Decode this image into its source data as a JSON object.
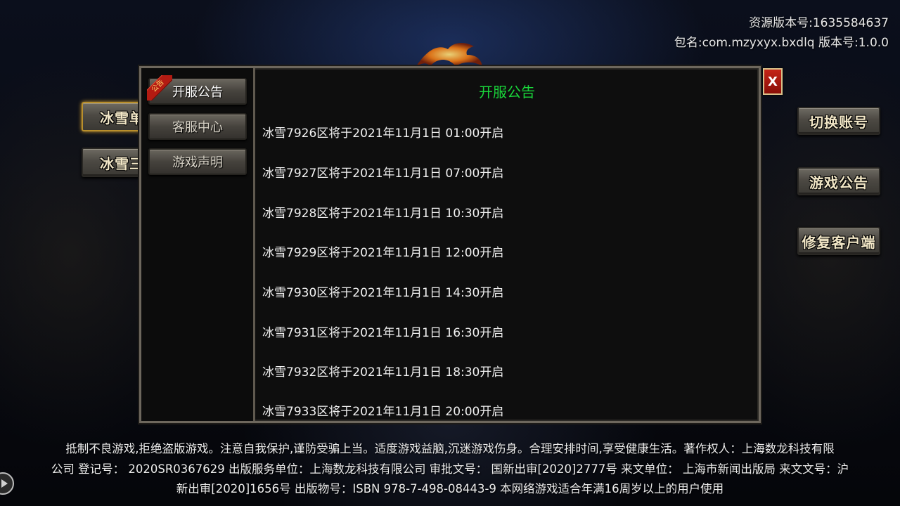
{
  "top_info": {
    "resource_version": "资源版本号:1635584637",
    "package": "包名:com.mzyxyx.bxdlq   版本号:1.0.0"
  },
  "left_buttons": [
    {
      "label": "冰雪单"
    },
    {
      "label": "冰雪三"
    }
  ],
  "right_buttons": [
    {
      "label": "切换账号"
    },
    {
      "label": "游戏公告"
    },
    {
      "label": "修复客户端"
    }
  ],
  "panel": {
    "tabs": [
      {
        "label": "开服公告"
      },
      {
        "label": "客服中心"
      },
      {
        "label": "游戏声明"
      }
    ],
    "ribbon_text": "公告",
    "content_title": "开服公告",
    "lines": [
      "冰雪7926区将于2021年11月1日 01:00开启",
      "冰雪7927区将于2021年11月1日 07:00开启",
      "冰雪7928区将于2021年11月1日 10:30开启",
      "冰雪7929区将于2021年11月1日 12:00开启",
      "冰雪7930区将于2021年11月1日 14:30开启",
      "冰雪7931区将于2021年11月1日 16:30开启",
      "冰雪7932区将于2021年11月1日 18:30开启",
      "冰雪7933区将于2021年11月1日 20:00开启"
    ],
    "close_label": "X"
  },
  "footer": {
    "line1": "抵制不良游戏,拒绝盗版游戏。注意自我保护,谨防受骗上当。适度游戏益脑,沉迷游戏伤身。合理安排时间,享受健康生活。著作权人：上海数龙科技有限",
    "line2": "公司 登记号： 2020SR0367629 出版服务单位：上海数龙科技有限公司 审批文号： 国新出审[2020]2777号 来文单位： 上海市新闻出版局 来文文号：沪",
    "line3": "新出审[2020]1656号 出版物号：ISBN 978-7-498-08443-9 本网络游戏适合年满16周岁以上的用户使用"
  },
  "icons": {
    "dragon_logo": "dragon-logo-icon",
    "float": "floating-assist-icon"
  },
  "colors": {
    "title_green": "#19d63a",
    "close_red": "#c42417",
    "button_text": "#f1e6c6"
  }
}
